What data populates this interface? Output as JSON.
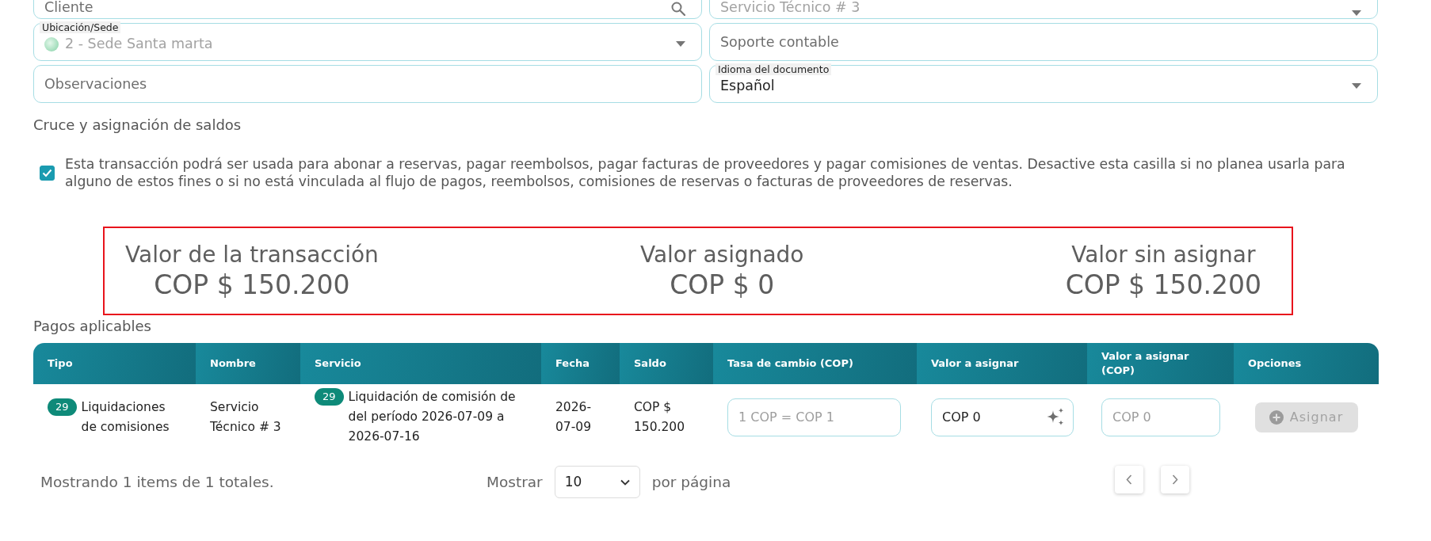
{
  "form": {
    "rows": [
      {
        "fields": [
          {
            "kind": "search",
            "placeholder": "Cliente"
          },
          {
            "kind": "select",
            "value": "Servicio Técnico # 3",
            "disabled": true
          }
        ]
      },
      {
        "fields": [
          {
            "kind": "select",
            "label": "Ubicación/Sede",
            "value": "2 - Sede Santa marta",
            "disabled": true,
            "dot": true
          },
          {
            "kind": "text",
            "placeholder": "Soporte contable"
          }
        ]
      },
      {
        "fields": [
          {
            "kind": "text",
            "placeholder": "Observaciones"
          },
          {
            "kind": "select",
            "label": "Idioma del documento",
            "value": "Español",
            "disabled": false
          }
        ]
      }
    ]
  },
  "balance_crossing": {
    "title": "Cruce y asignación de saldos",
    "option": {
      "checked": true,
      "label": "Esta transacción podrá ser usada para abonar a reservas, pagar reembolsos, pagar facturas de proveedores y pagar comisiones de ventas. Desactive esta casilla si no planea usarla para alguno de estos fines o si no está vinculada al flujo de pagos, reembolsos, comisiones de reservas o facturas de proveedores de reservas."
    }
  },
  "summary": [
    {
      "label": "Valor de la transacción",
      "value": "COP $ 150.200"
    },
    {
      "label": "Valor asignado",
      "value": "COP $ 0"
    },
    {
      "label": "Valor sin asignar",
      "value": "COP $ 150.200"
    }
  ],
  "payments": {
    "title": "Pagos aplicables",
    "columns": [
      "Tipo",
      "Nombre",
      "Servicio",
      "Fecha",
      "Saldo",
      "Tasa de cambio (COP)",
      "Valor a asignar",
      "Valor a asignar (COP)",
      "Opciones"
    ],
    "rows": [
      {
        "type": {
          "badge": "29",
          "text": "Liquidaciones de comisiones"
        },
        "name": "Servicio Técnico # 3",
        "service": {
          "badge": "29",
          "text": "Liquidación de comisión de del período 2026-07-09 a 2026-07-16"
        },
        "date": "2026-07-09",
        "balance": "COP $ 150.200",
        "exchange_rate": {
          "placeholder": "1 COP = COP 1"
        },
        "amount": {
          "value": "COP 0"
        },
        "amount_cop": {
          "placeholder": "COP 0"
        },
        "action": {
          "label": "Asignar",
          "disabled": true
        }
      }
    ]
  },
  "footer": {
    "summary": "Mostrando 1 items de 1 totales.",
    "show_label": "Mostrar",
    "page_size": "10",
    "per_page_label": "por página"
  }
}
